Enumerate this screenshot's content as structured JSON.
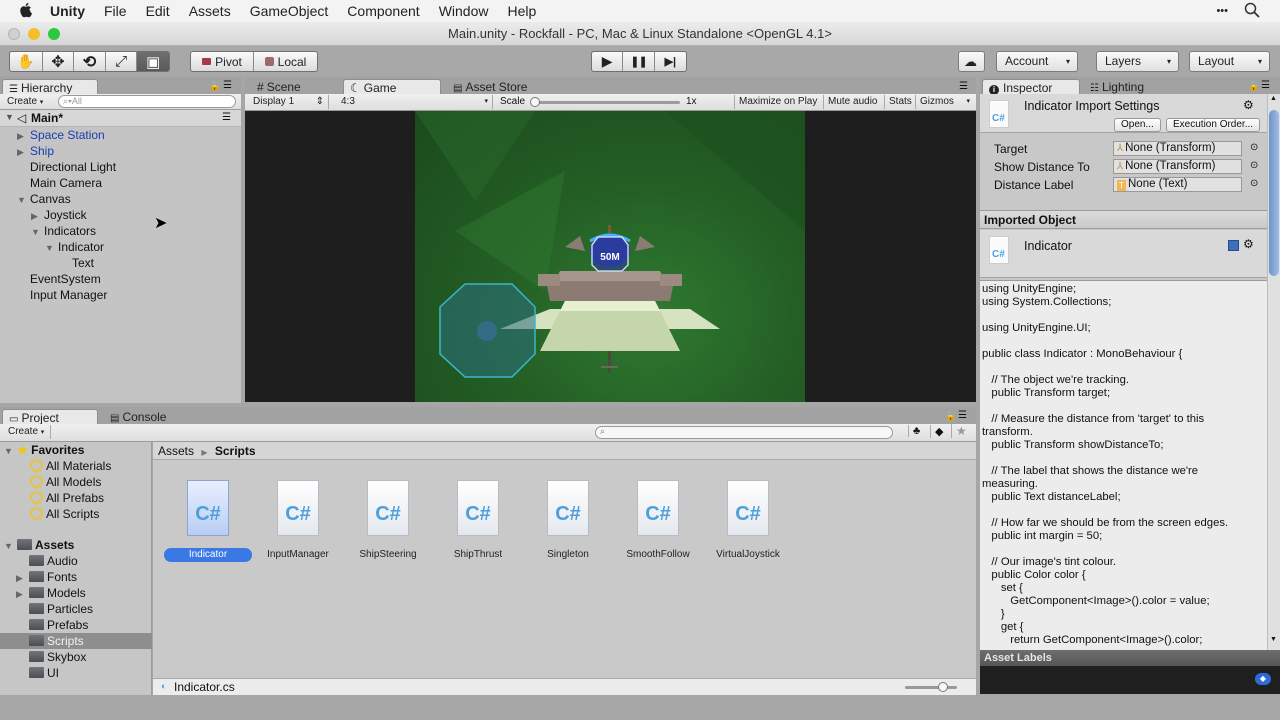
{
  "menubar": {
    "apple_icon": "apple-logo",
    "app_name": "Unity",
    "items": [
      "File",
      "Edit",
      "Assets",
      "GameObject",
      "Component",
      "Window",
      "Help"
    ],
    "right_icons": [
      "more-icon",
      "spotlight-search-icon"
    ],
    "more_glyph": "•••",
    "search_glyph": "⌕"
  },
  "window": {
    "title": "Main.unity - Rockfall - PC, Mac & Linux Standalone <OpenGL 4.1>"
  },
  "toolbar": {
    "tools": [
      {
        "name": "hand-tool",
        "glyph": "✋"
      },
      {
        "name": "move-tool",
        "glyph": "✥"
      },
      {
        "name": "rotate-tool",
        "glyph": "⟲"
      },
      {
        "name": "scale-tool",
        "glyph": "⤢"
      },
      {
        "name": "rect-tool",
        "glyph": "▣"
      }
    ],
    "pivot_label": "Pivot",
    "local_label": "Local",
    "play_glyph": "▶",
    "pause_glyph": "❚❚",
    "step_glyph": "▶|",
    "cloud_glyph": "☁",
    "account_label": "Account",
    "layers_label": "Layers",
    "layout_label": "Layout",
    "dropdown_glyph": "▾"
  },
  "hierarchy": {
    "tab_label": "Hierarchy",
    "create_label": "Create",
    "search_placeholder": "All",
    "scene_name": "Main*",
    "items": [
      {
        "label": "Space Station",
        "depth": 0,
        "expander": "collapsed",
        "prefab": true
      },
      {
        "label": "Ship",
        "depth": 0,
        "expander": "collapsed",
        "prefab": true
      },
      {
        "label": "Directional Light",
        "depth": 0,
        "expander": "none",
        "prefab": false
      },
      {
        "label": "Main Camera",
        "depth": 0,
        "expander": "none",
        "prefab": false
      },
      {
        "label": "Canvas",
        "depth": 0,
        "expander": "expanded",
        "prefab": false
      },
      {
        "label": "Joystick",
        "depth": 1,
        "expander": "collapsed",
        "prefab": false
      },
      {
        "label": "Indicators",
        "depth": 1,
        "expander": "expanded",
        "prefab": false
      },
      {
        "label": "Indicator",
        "depth": 2,
        "expander": "expanded",
        "prefab": false
      },
      {
        "label": "Text",
        "depth": 3,
        "expander": "none",
        "prefab": false
      },
      {
        "label": "EventSystem",
        "depth": 0,
        "expander": "none",
        "prefab": false
      },
      {
        "label": "Input Manager",
        "depth": 0,
        "expander": "none",
        "prefab": false
      }
    ]
  },
  "center_tabs": {
    "tabs": [
      {
        "label": "Scene",
        "icon": "#"
      },
      {
        "label": "Game",
        "icon": "☾",
        "active": true
      },
      {
        "label": "Asset Store",
        "icon": "🛍"
      }
    ]
  },
  "game_toolbar": {
    "display": "Display 1",
    "aspect": "4:3",
    "scale_label": "Scale",
    "scale_value": "1x",
    "scale_fraction": 0.0,
    "maximize_on_play": "Maximize on Play",
    "mute_audio": "Mute audio",
    "stats": "Stats",
    "gizmos": "Gizmos"
  },
  "game_view": {
    "distance_label": "50M"
  },
  "inspector": {
    "tab_label": "Inspector",
    "lighting_tab_label": "Lighting",
    "title": "Indicator Import Settings",
    "open_button": "Open...",
    "execution_order_button": "Execution Order...",
    "fields": [
      {
        "label": "Target",
        "value": "None (Transform)",
        "icon": "transform-icon"
      },
      {
        "label": "Show Distance To",
        "value": "None (Transform)",
        "icon": "transform-icon"
      },
      {
        "label": "Distance Label",
        "value": "None (Text)",
        "icon": "text-icon"
      }
    ],
    "imported_object_header": "Imported Object",
    "imported_object_name": "Indicator",
    "code": "using UnityEngine;\nusing System.Collections;\n\nusing UnityEngine.UI;\n\npublic class Indicator : MonoBehaviour {\n\n   // The object we're tracking.\n   public Transform target;\n\n   // Measure the distance from 'target' to this\ntransform.\n   public Transform showDistanceTo;\n\n   // The label that shows the distance we're\nmeasuring.\n   public Text distanceLabel;\n\n   // How far we should be from the screen edges.\n   public int margin = 50;\n\n   // Our image's tint colour.\n   public Color color {\n      set {\n         GetComponent<Image>().color = value;\n      }\n      get {\n         return GetComponent<Image>().color;",
    "asset_labels_header": "Asset Labels"
  },
  "project": {
    "tab_label": "Project",
    "console_tab_label": "Console",
    "create_label": "Create",
    "search_placeholder": "",
    "favorites": {
      "label": "Favorites",
      "items": [
        "All Materials",
        "All Models",
        "All Prefabs",
        "All Scripts"
      ]
    },
    "assets": {
      "label": "Assets",
      "items": [
        {
          "label": "Audio",
          "expander": false
        },
        {
          "label": "Fonts",
          "expander": true
        },
        {
          "label": "Models",
          "expander": true
        },
        {
          "label": "Particles",
          "expander": false
        },
        {
          "label": "Prefabs",
          "expander": false
        },
        {
          "label": "Scripts",
          "expander": false,
          "selected": true
        },
        {
          "label": "Skybox",
          "expander": false
        },
        {
          "label": "UI",
          "expander": false
        }
      ]
    },
    "breadcrumb": [
      "Assets",
      "Scripts"
    ],
    "files": [
      {
        "label": "Indicator",
        "selected": true
      },
      {
        "label": "InputManager"
      },
      {
        "label": "ShipSteering"
      },
      {
        "label": "ShipThrust"
      },
      {
        "label": "Singleton"
      },
      {
        "label": "SmoothFollow"
      },
      {
        "label": "VirtualJoystick"
      }
    ],
    "file_glyph": "C#",
    "status_file": "Indicator.cs",
    "icon_size_fraction": 0.8
  },
  "colors": {
    "selection_blue": "#3a78e6",
    "prefab_blue": "#1a3db0",
    "game_green": "#245f25"
  }
}
